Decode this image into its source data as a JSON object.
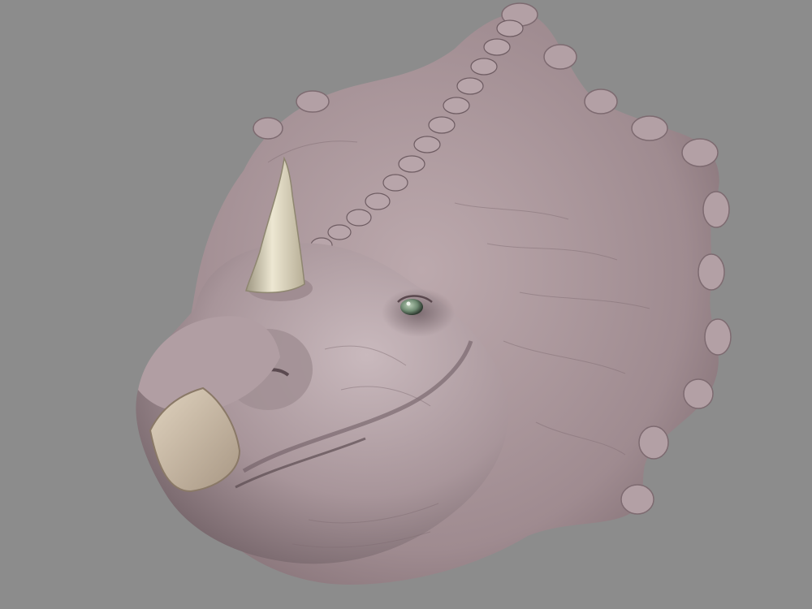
{
  "scene": {
    "background_color": "#8c8c8c",
    "subject": "triceratops-head-sculpt",
    "skin_color": "#a8959a",
    "skin_highlight_color": "#c9b9bd",
    "skin_shadow_color": "#5f4f55",
    "horn_color": "#ded7c0",
    "beak_color": "#c8b9a6",
    "eye_color": "#6f8a72"
  }
}
